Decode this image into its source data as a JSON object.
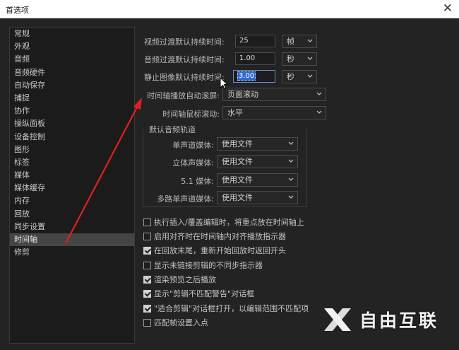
{
  "window": {
    "title": "首选项",
    "close_glyph": "✕"
  },
  "sidebar": {
    "items": [
      {
        "label": "常规"
      },
      {
        "label": "外观"
      },
      {
        "label": "音频"
      },
      {
        "label": "音频硬件"
      },
      {
        "label": "自动保存"
      },
      {
        "label": "捕捉"
      },
      {
        "label": "协作"
      },
      {
        "label": "操纵面板"
      },
      {
        "label": "设备控制"
      },
      {
        "label": "图形"
      },
      {
        "label": "标签"
      },
      {
        "label": "媒体"
      },
      {
        "label": "媒体缓存"
      },
      {
        "label": "内存"
      },
      {
        "label": "回放"
      },
      {
        "label": "同步设置"
      },
      {
        "label": "时间轴"
      },
      {
        "label": "修剪"
      }
    ],
    "active": "时间轴"
  },
  "durations": {
    "video": {
      "label": "视频过渡默认持续时间:",
      "value": "25",
      "unit": "帧"
    },
    "audio": {
      "label": "音频过渡默认持续时间:",
      "value": "1.00",
      "unit": "秒"
    },
    "still": {
      "label": "静止图像默认持续时间:",
      "value": "3.00",
      "unit": "秒"
    }
  },
  "autoscroll": {
    "label": "时间轴播放自动滚屏:",
    "value": "页面滚动"
  },
  "mousescroll": {
    "label": "时间轴鼠标滚动:",
    "value": "水平"
  },
  "audio_tracks": {
    "title": "默认音频轨道",
    "rows": [
      {
        "label": "单声道媒体:",
        "value": "使用文件"
      },
      {
        "label": "立体声媒体:",
        "value": "使用文件"
      },
      {
        "label": "5.1 媒体:",
        "value": "使用文件"
      },
      {
        "label": "多路单声道媒体:",
        "value": "使用文件"
      }
    ]
  },
  "options": [
    {
      "label": "执行插入/覆盖编辑时，将重点放在时间轴上",
      "checked": false
    },
    {
      "label": "启用对齐时在时间轴内对齐播放指示器",
      "checked": false
    },
    {
      "label": "在回放末尾，重新开始回放时返回开头",
      "checked": true
    },
    {
      "label": "显示未链接剪辑的不同步指示器",
      "checked": false
    },
    {
      "label": "渲染预览之后播放",
      "checked": true
    },
    {
      "label": "显示\"剪辑不匹配警告\"对话框",
      "checked": true
    },
    {
      "label": "\"适合剪辑\"对话框打开，以编辑范围不匹配项",
      "checked": true
    },
    {
      "label": "匹配帧设置入点",
      "checked": false
    }
  ],
  "watermark": {
    "text": "自由互联"
  },
  "colors": {
    "background": "#232323",
    "active_item": "#454545",
    "selection": "#2f6ccf",
    "annotation_arrow": "#e02020"
  }
}
